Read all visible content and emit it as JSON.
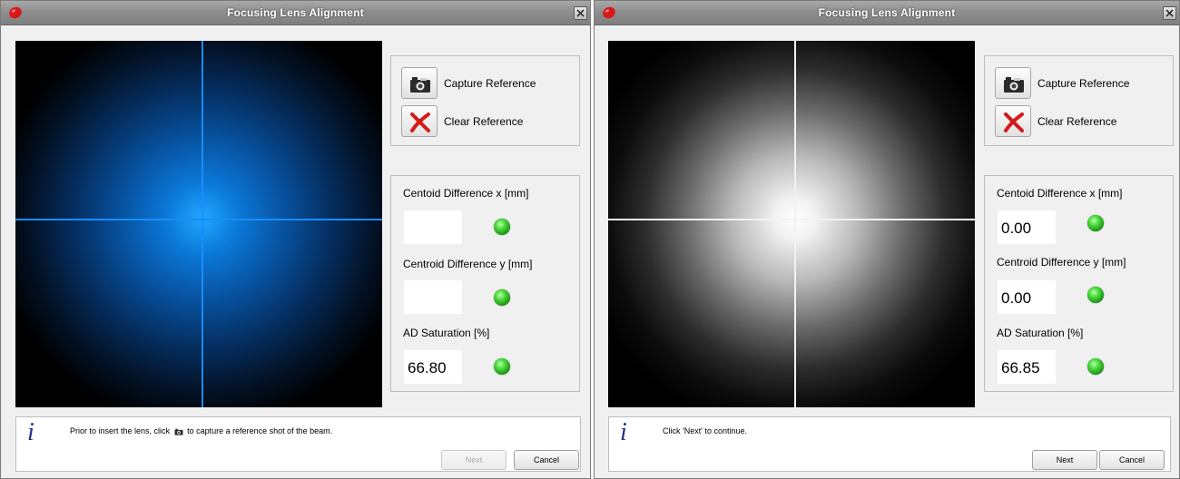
{
  "windows": [
    {
      "title": "Focusing Lens Alignment",
      "reference": {
        "capture_label": "Capture Reference",
        "clear_label": "Clear Reference"
      },
      "status": {
        "centroid_x_label": "Centoid Difference x [mm]",
        "centroid_x_value": "",
        "centroid_y_label": "Centroid Difference y [mm]",
        "centroid_y_value": "",
        "saturation_label": "AD Saturation [%]",
        "saturation_value": "66.80"
      },
      "info": {
        "text_before": "Prior to insert the lens, click",
        "text_after": "to capture a reference shot of the beam."
      },
      "buttons": {
        "next": "Next",
        "cancel": "Cancel",
        "next_enabled": false
      }
    },
    {
      "title": "Focusing Lens Alignment",
      "reference": {
        "capture_label": "Capture Reference",
        "clear_label": "Clear Reference"
      },
      "status": {
        "centroid_x_label": "Centoid Difference x [mm]",
        "centroid_x_value": "0.00",
        "centroid_y_label": "Centroid Difference y [mm]",
        "centroid_y_value": "0.00",
        "saturation_label": "AD Saturation [%]",
        "saturation_value": "66.85"
      },
      "info": {
        "text_before": "Click 'Next' to continue.",
        "text_after": ""
      },
      "buttons": {
        "next": "Next",
        "cancel": "Cancel",
        "next_enabled": true
      }
    }
  ],
  "icons": {
    "app_logo": "red-blob-icon",
    "close": "close-icon",
    "capture": "camera-icon",
    "clear": "red-x-icon",
    "info": "info-icon",
    "status_led": "green-led-icon"
  },
  "colors": {
    "led_ok": "#3cc832",
    "crosshair_left": "#1a8cff",
    "crosshair_right": "#f2f2f2",
    "info_icon": "#1f2f8a"
  }
}
